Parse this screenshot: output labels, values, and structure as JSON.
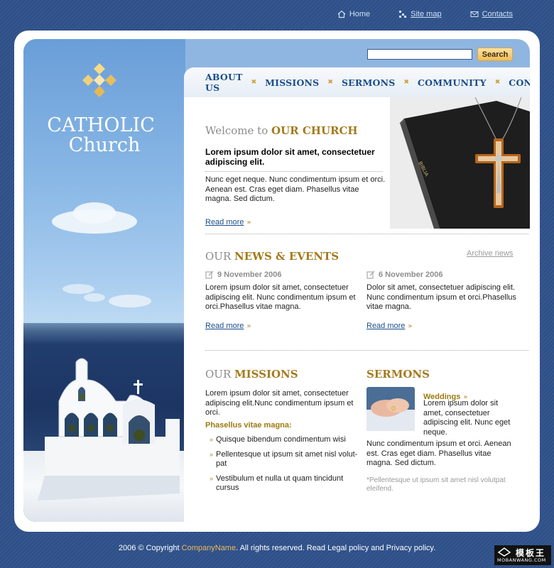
{
  "top_links": {
    "home": "Home",
    "sitemap": "Site map",
    "contacts": "Contacts"
  },
  "logo": {
    "line1": "CATHOLIC",
    "line2": "Church"
  },
  "search": {
    "value": "",
    "button": "Search"
  },
  "nav": {
    "items": [
      "ABOUT US",
      "MISSIONS",
      "SERMONS",
      "COMMUNITY",
      "CONTACTS"
    ]
  },
  "welcome": {
    "title_pre": "Welcome to ",
    "title_hl": "OUR CHURCH",
    "lead": "Lorem ipsum dolor sit amet, consectetuer adipiscing elit.",
    "body": "Nunc eget neque. Nunc condimentum ipsum et orci. Aenean est. Cras eget diam. Phasellus vitae magna. Sed dictum.",
    "read_more": "Read more"
  },
  "news": {
    "title_pre": "OUR ",
    "title_hl": "NEWS & EVENTS",
    "archive": "Archive news",
    "items": [
      {
        "date": "9 November 2006",
        "text": "Lorem ipsum dolor sit amet, consectetuer adipiscing elit.  Nunc condimentum ipsum et orci.Phasellus vitae magna.",
        "read_more": "Read more"
      },
      {
        "date": "6 November 2006",
        "text": "Dolor sit amet, consectetuer adipiscing elit. Nunc condimentum ipsum et orci.Phasellus vitae magna.",
        "read_more": "Read more"
      }
    ]
  },
  "missions": {
    "title_pre": "OUR ",
    "title_hl": "MISSIONS",
    "body": "Lorem ipsum dolor sit amet, consectetuer adipiscing elit.Nunc condimentum ipsum et orci.",
    "subtitle": "Phasellus vitae magna:",
    "list": [
      "Quisque bibendum condimentum wisi",
      "Pellentesque ut ipsum sit amet nisl volut-pat",
      "Vestibulum et nulla ut quam tincidunt cursus"
    ]
  },
  "sermons": {
    "title": "SERMONS",
    "item_title": "Weddings",
    "item_text": "Lorem ipsum dolor sit amet, consectetuer adipiscing elit. Nunc eget neque.",
    "body": "Nunc condimentum ipsum et orci. Aenean est. Cras eget diam. Phasellus vitae magna. Sed dictum.",
    "note": "*Pellentesque ut ipsum sit amet nisl volutpat eleifend."
  },
  "footer": {
    "pre": "2006 © Copyright ",
    "company": "CompanyName",
    "post": ". All rights reserved. Read Legal policy and Privacy policy."
  },
  "watermark": {
    "title": "模板王",
    "url": "MOBANWANG.COM"
  },
  "colors": {
    "background": "#2f4f86",
    "nav_text": "#1a4e8a",
    "gold": "#a47a1c",
    "search_button": "#f2bc56"
  },
  "icons": [
    "home-icon",
    "sitemap-icon",
    "envelope-icon",
    "diamond-logo-icon",
    "note-icon",
    "arrow-icon"
  ]
}
